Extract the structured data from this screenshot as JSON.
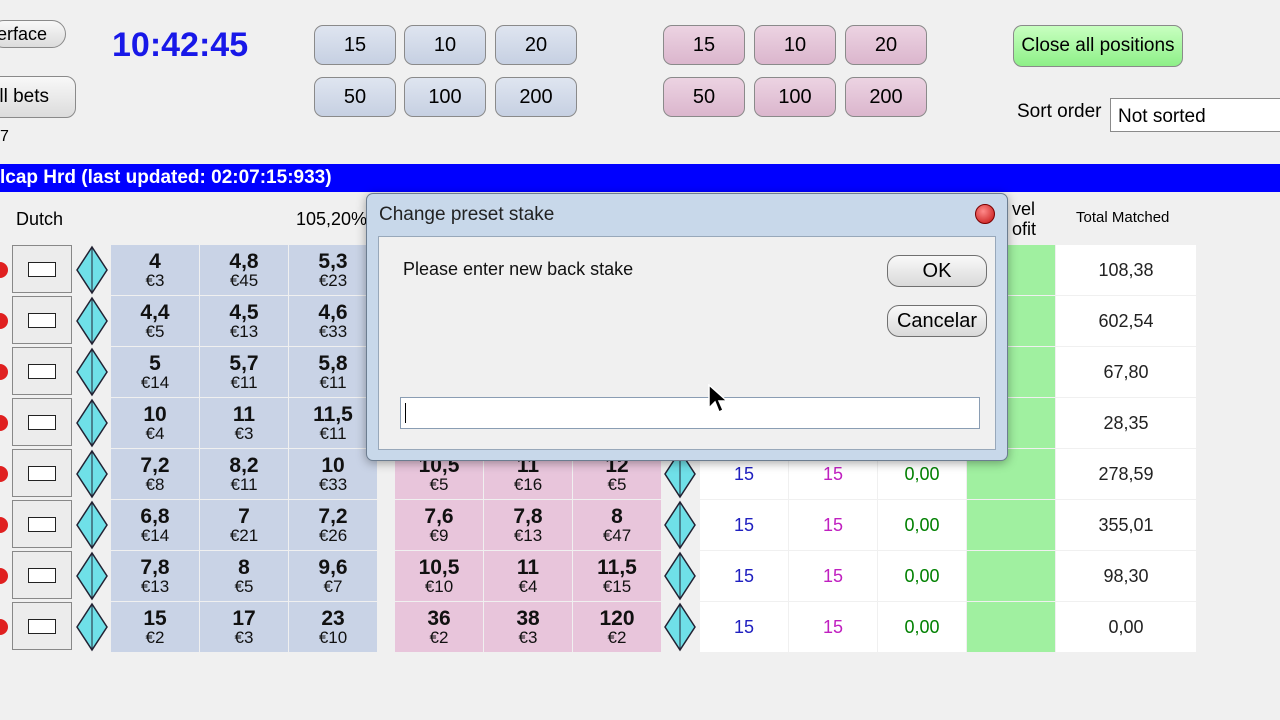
{
  "toolbar": {
    "interface_label": "erface",
    "allbets_label": "ll bets",
    "small_text": "7",
    "clock": "10:42:45",
    "back_stakes": [
      "15",
      "10",
      "20",
      "50",
      "100",
      "200"
    ],
    "lay_stakes": [
      "15",
      "10",
      "20",
      "50",
      "100",
      "200"
    ],
    "close_all": "Close all positions",
    "sort_label": "Sort order",
    "sort_value": "Not sorted"
  },
  "market": {
    "title": "lcap Hrd (last updated: 02:07:15:933)",
    "dutch_label": "Dutch",
    "percent": "105,20%",
    "level_profit": [
      "vel",
      "ofit"
    ],
    "total_matched_label": "Total Matched"
  },
  "rows": [
    {
      "b": [
        [
          "4",
          "€3"
        ],
        [
          "4,8",
          "€45"
        ],
        [
          "5,3",
          "€23"
        ]
      ],
      "l": [
        [
          "",
          "",
          ""
        ],
        [
          "",
          ""
        ],
        [
          "",
          ""
        ]
      ],
      "s1": "",
      "s2": "",
      "pl": "",
      "tm": "108,38"
    },
    {
      "b": [
        [
          "4,4",
          "€5"
        ],
        [
          "4,5",
          "€13"
        ],
        [
          "4,6",
          "€33"
        ]
      ],
      "l": [
        [
          "",
          ""
        ],
        [
          "",
          ""
        ],
        [
          "",
          ""
        ]
      ],
      "s1": "",
      "s2": "",
      "pl": "",
      "tm": "602,54"
    },
    {
      "b": [
        [
          "5",
          "€14"
        ],
        [
          "5,7",
          "€11"
        ],
        [
          "5,8",
          "€11"
        ]
      ],
      "l": [
        [
          "",
          ""
        ],
        [
          "",
          ""
        ],
        [
          "",
          ""
        ]
      ],
      "s1": "",
      "s2": "",
      "pl": "",
      "tm": "67,80"
    },
    {
      "b": [
        [
          "10",
          "€4"
        ],
        [
          "11",
          "€3"
        ],
        [
          "11,5",
          "€11"
        ]
      ],
      "l": [
        [
          "",
          ""
        ],
        [
          "",
          ""
        ],
        [
          "",
          ""
        ]
      ],
      "s1": "",
      "s2": "",
      "pl": "",
      "tm": "28,35"
    },
    {
      "b": [
        [
          "7,2",
          "€8"
        ],
        [
          "8,2",
          "€11"
        ],
        [
          "10",
          "€33"
        ]
      ],
      "l": [
        [
          "10,5",
          "€5"
        ],
        [
          "11",
          "€16"
        ],
        [
          "12",
          "€5"
        ]
      ],
      "s1": "15",
      "s2": "15",
      "pl": "0,00",
      "tm": "278,59"
    },
    {
      "b": [
        [
          "6,8",
          "€14"
        ],
        [
          "7",
          "€21"
        ],
        [
          "7,2",
          "€26"
        ]
      ],
      "l": [
        [
          "7,6",
          "€9"
        ],
        [
          "7,8",
          "€13"
        ],
        [
          "8",
          "€47"
        ]
      ],
      "s1": "15",
      "s2": "15",
      "pl": "0,00",
      "tm": "355,01"
    },
    {
      "b": [
        [
          "7,8",
          "€13"
        ],
        [
          "8",
          "€5"
        ],
        [
          "9,6",
          "€7"
        ]
      ],
      "l": [
        [
          "10,5",
          "€10"
        ],
        [
          "11",
          "€4"
        ],
        [
          "11,5",
          "€15"
        ]
      ],
      "s1": "15",
      "s2": "15",
      "pl": "0,00",
      "tm": "98,30"
    },
    {
      "b": [
        [
          "15",
          "€2"
        ],
        [
          "17",
          "€3"
        ],
        [
          "23",
          "€10"
        ]
      ],
      "l": [
        [
          "36",
          "€2"
        ],
        [
          "38",
          "€3"
        ],
        [
          "120",
          "€2"
        ]
      ],
      "s1": "15",
      "s2": "15",
      "pl": "0,00",
      "tm": "0,00"
    }
  ],
  "dialog": {
    "title": "Change preset stake",
    "prompt": "Please enter new back stake",
    "ok": "OK",
    "cancel": "Cancelar",
    "input_value": ""
  },
  "colors": {
    "clock": "#1818e8",
    "title_bar": "#0000ff",
    "back": "#c9d3e6",
    "lay": "#e8c5db",
    "profit": "#a0f0a0",
    "stake_back_text": "#2020c0",
    "stake_lay_text": "#c020c0"
  }
}
